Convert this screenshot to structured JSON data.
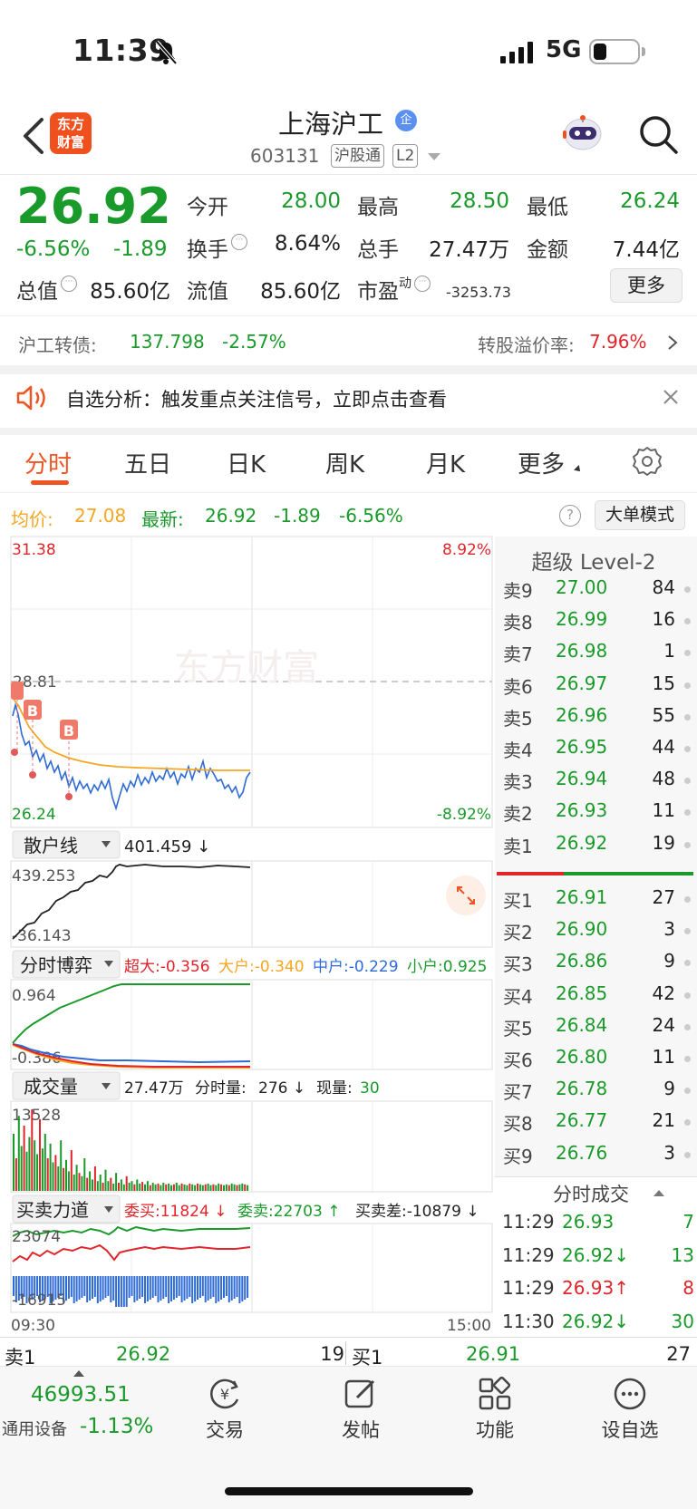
{
  "status": {
    "time": "11:39",
    "network": "5G"
  },
  "header": {
    "logo": "东方财富",
    "name": "上海沪工",
    "corp_badge": "企",
    "code": "603131",
    "tag1": "沪股通",
    "tag2": "L2"
  },
  "quote": {
    "price": "26.92",
    "pct": "-6.56%",
    "change": "-1.89",
    "open_label": "今开",
    "open": "28.00",
    "high_label": "最高",
    "high": "28.50",
    "low_label": "最低",
    "low": "26.24",
    "turnover_label": "换手",
    "turnover": "8.64%",
    "volume_label": "总手",
    "volume": "27.47万",
    "amount_label": "金额",
    "amount": "7.44亿",
    "mcap_label": "总值",
    "mcap": "85.60亿",
    "float_label": "流值",
    "float": "85.60亿",
    "pe_label": "市盈",
    "pe_sup": "动",
    "pe": "-3253.73",
    "more": "更多"
  },
  "bond": {
    "label": "沪工转债:",
    "price": "137.798",
    "pct": "-2.57%",
    "premium_label": "转股溢价率:",
    "premium": "7.96%"
  },
  "alert": {
    "text": "自选分析：触发重点关注信号，立即点击查看"
  },
  "tabs": [
    "分时",
    "五日",
    "日K",
    "周K",
    "月K",
    "更多"
  ],
  "info": {
    "avg_label": "均价:",
    "avg": "27.08",
    "latest_label": "最新:",
    "latest": "26.92",
    "latest_chg": "-1.89",
    "latest_pct": "-6.56%",
    "help": "?",
    "bigorder": "大单模式"
  },
  "chart": {
    "y_top": "31.38",
    "y_mid": "28.81",
    "y_bot": "26.24",
    "pct_top": "8.92%",
    "pct_bot": "-8.92%",
    "watermark": "东方财富",
    "buy_marker": "B",
    "retail_label": "散户线",
    "retail_value": "401.459 ↓",
    "retail_top": "439.253",
    "retail_bot": "-36.143",
    "game_label": "分时博弈",
    "game_legend": [
      {
        "text": "超大:-0.356",
        "color": "#e0252b"
      },
      {
        "text": "大户:-0.340",
        "color": "#f5a623"
      },
      {
        "text": "中户:-0.229",
        "color": "#2f6bd6"
      },
      {
        "text": "小户:0.925",
        "color": "#1a9a2a"
      }
    ],
    "game_top": "0.964",
    "game_bot": "-0.386",
    "vol_label": "成交量",
    "vol_total": "27.47万",
    "vol_period_label": "分时量:",
    "vol_period": "276 ↓",
    "vol_now_label": "现量:",
    "vol_now": "30",
    "vol_top": "13528",
    "force_label": "买卖力道",
    "force_buy": "委买:11824 ↓",
    "force_sell": "委卖:22703 ↑",
    "force_diff": "买卖差:-10879 ↓",
    "force_top": "23074",
    "force_bot": "-16915",
    "time_start": "09:30",
    "time_end": "15:00"
  },
  "level2": {
    "title": "超级 Level-2",
    "asks": [
      {
        "label": "卖9",
        "price": "27.00",
        "vol": "84"
      },
      {
        "label": "卖8",
        "price": "26.99",
        "vol": "16"
      },
      {
        "label": "卖7",
        "price": "26.98",
        "vol": "1"
      },
      {
        "label": "卖6",
        "price": "26.97",
        "vol": "15"
      },
      {
        "label": "卖5",
        "price": "26.96",
        "vol": "55"
      },
      {
        "label": "卖4",
        "price": "26.95",
        "vol": "44"
      },
      {
        "label": "卖3",
        "price": "26.94",
        "vol": "48"
      },
      {
        "label": "卖2",
        "price": "26.93",
        "vol": "11"
      },
      {
        "label": "卖1",
        "price": "26.92",
        "vol": "19"
      }
    ],
    "bids": [
      {
        "label": "买1",
        "price": "26.91",
        "vol": "27"
      },
      {
        "label": "买2",
        "price": "26.90",
        "vol": "3"
      },
      {
        "label": "买3",
        "price": "26.86",
        "vol": "9"
      },
      {
        "label": "买4",
        "price": "26.85",
        "vol": "42"
      },
      {
        "label": "买5",
        "price": "26.84",
        "vol": "24"
      },
      {
        "label": "买6",
        "price": "26.80",
        "vol": "11"
      },
      {
        "label": "买7",
        "price": "26.78",
        "vol": "9"
      },
      {
        "label": "买8",
        "price": "26.77",
        "vol": "21"
      },
      {
        "label": "买9",
        "price": "26.76",
        "vol": "3"
      }
    ],
    "ticks_title": "分时成交",
    "ticks": [
      {
        "time": "11:29",
        "price": "26.93",
        "vol": "7",
        "color": "#1a9a2a"
      },
      {
        "time": "11:29",
        "price": "26.92↓",
        "vol": "13",
        "color": "#1a9a2a"
      },
      {
        "time": "11:29",
        "price": "26.93↑",
        "vol": "8",
        "color": "#e0252b"
      },
      {
        "time": "11:30",
        "price": "26.92↓",
        "vol": "30",
        "color": "#1a9a2a"
      }
    ]
  },
  "bottom_quote": {
    "ask_label": "卖1",
    "ask_price": "26.92",
    "ask_vol": "19",
    "bid_label": "买1",
    "bid_price": "26.91",
    "bid_vol": "27"
  },
  "nav": {
    "index_value": "46993.51",
    "index_name": "通用设备",
    "index_pct": "-1.13%",
    "items": [
      "交易",
      "发帖",
      "功能",
      "设自选"
    ]
  }
}
